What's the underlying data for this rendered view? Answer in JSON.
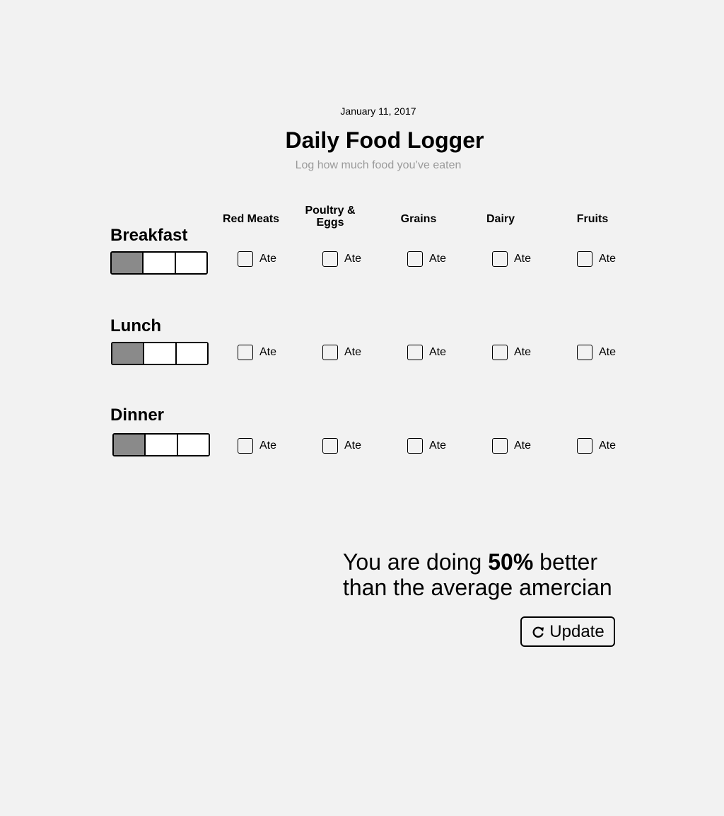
{
  "header": {
    "date": "January 11, 2017",
    "title": "Daily Food Logger",
    "subtitle": "Log how much food you’ve eaten"
  },
  "columns": [
    {
      "label": "Red Meats"
    },
    {
      "label": "Poultry &\nEggs"
    },
    {
      "label": "Grains"
    },
    {
      "label": "Dairy"
    },
    {
      "label": "Fruits"
    }
  ],
  "ate_label": "Ate",
  "meals": [
    {
      "name": "Breakfast",
      "portion_filled": 1,
      "portion_total": 3,
      "ate": [
        false,
        false,
        false,
        false,
        false
      ]
    },
    {
      "name": "Lunch",
      "portion_filled": 1,
      "portion_total": 3,
      "ate": [
        false,
        false,
        false,
        false,
        false
      ]
    },
    {
      "name": "Dinner",
      "portion_filled": 1,
      "portion_total": 3,
      "ate": [
        false,
        false,
        false,
        false,
        false
      ]
    }
  ],
  "summary": {
    "prefix": "You are doing ",
    "percent": "50%",
    "suffix": " better than the average amercian"
  },
  "update_button": {
    "label": "Update",
    "icon": "refresh-icon"
  },
  "colors": {
    "background": "#f2f2f2",
    "portion_filled": "#8a8a8a",
    "subtitle": "#9a9a9a"
  }
}
